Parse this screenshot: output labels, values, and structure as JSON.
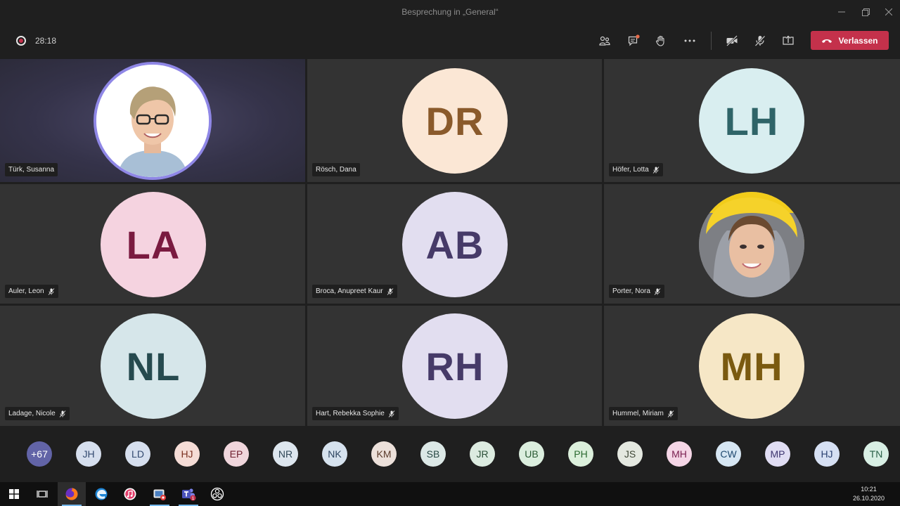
{
  "window": {
    "title": "Besprechung in „General“"
  },
  "toolbar": {
    "timer": "28:18",
    "leave_label": "Verlassen",
    "accent": "#c4314b"
  },
  "tiles": [
    {
      "name": "Türk, Susanna",
      "initials": "",
      "muted": false,
      "photo": true,
      "bg": "",
      "fg": ""
    },
    {
      "name": "Rösch, Dana",
      "initials": "DR",
      "muted": false,
      "photo": false,
      "bg": "#fbe7d5",
      "fg": "#8a5a2b"
    },
    {
      "name": "Höfer, Lotta",
      "initials": "LH",
      "muted": true,
      "photo": false,
      "bg": "#d9eef0",
      "fg": "#2f6468"
    },
    {
      "name": "Auler, Leon",
      "initials": "LA",
      "muted": true,
      "photo": false,
      "bg": "#f5d3e0",
      "fg": "#7a1a40"
    },
    {
      "name": "Broca, Anupreet Kaur",
      "initials": "AB",
      "muted": true,
      "photo": false,
      "bg": "#e2def0",
      "fg": "#463a68"
    },
    {
      "name": "Porter, Nora",
      "initials": "",
      "muted": true,
      "photo": true,
      "bg": "",
      "fg": ""
    },
    {
      "name": "Ladage, Nicole",
      "initials": "NL",
      "muted": true,
      "photo": false,
      "bg": "#d6e6ea",
      "fg": "#264a4f"
    },
    {
      "name": "Hart, Rebekka Sophie",
      "initials": "RH",
      "muted": true,
      "photo": false,
      "bg": "#e2def0",
      "fg": "#463a68"
    },
    {
      "name": "Hummel, Miriam",
      "initials": "MH",
      "muted": true,
      "photo": false,
      "bg": "#f6e7c6",
      "fg": "#7a5a10"
    }
  ],
  "strip": [
    {
      "label": "+67",
      "bg": "#6264a7",
      "fg": "#ffffff"
    },
    {
      "label": "JH",
      "bg": "#d6dfee",
      "fg": "#334a70"
    },
    {
      "label": "LD",
      "bg": "#d6dfee",
      "fg": "#334a70"
    },
    {
      "label": "HJ",
      "bg": "#f5dcd6",
      "fg": "#7a3020"
    },
    {
      "label": "EP",
      "bg": "#f0d6dc",
      "fg": "#6e2030"
    },
    {
      "label": "NR",
      "bg": "#dde6ee",
      "fg": "#304858"
    },
    {
      "label": "NK",
      "bg": "#d6e2ee",
      "fg": "#2c4460"
    },
    {
      "label": "KM",
      "bg": "#ece0da",
      "fg": "#5a3a2a"
    },
    {
      "label": "SB",
      "bg": "#dce8e6",
      "fg": "#2a4a46"
    },
    {
      "label": "JR",
      "bg": "#dcebe0",
      "fg": "#2c5038"
    },
    {
      "label": "UB",
      "bg": "#dbeede",
      "fg": "#2a5a34"
    },
    {
      "label": "PH",
      "bg": "#dcf0dc",
      "fg": "#2a6a30"
    },
    {
      "label": "JS",
      "bg": "#e4e8e0",
      "fg": "#404838"
    },
    {
      "label": "MH",
      "bg": "#f5d6e6",
      "fg": "#7a2050"
    },
    {
      "label": "CW",
      "bg": "#d6e6f3",
      "fg": "#204a70"
    },
    {
      "label": "MP",
      "bg": "#e0ddf3",
      "fg": "#3e3670"
    },
    {
      "label": "HJ",
      "bg": "#d6e0f3",
      "fg": "#2a4070"
    },
    {
      "label": "TN",
      "bg": "#d8efe4",
      "fg": "#2a6048"
    }
  ],
  "taskbar": {
    "time": "10:21",
    "date": "26.10.2020",
    "teams_badge": "1"
  }
}
